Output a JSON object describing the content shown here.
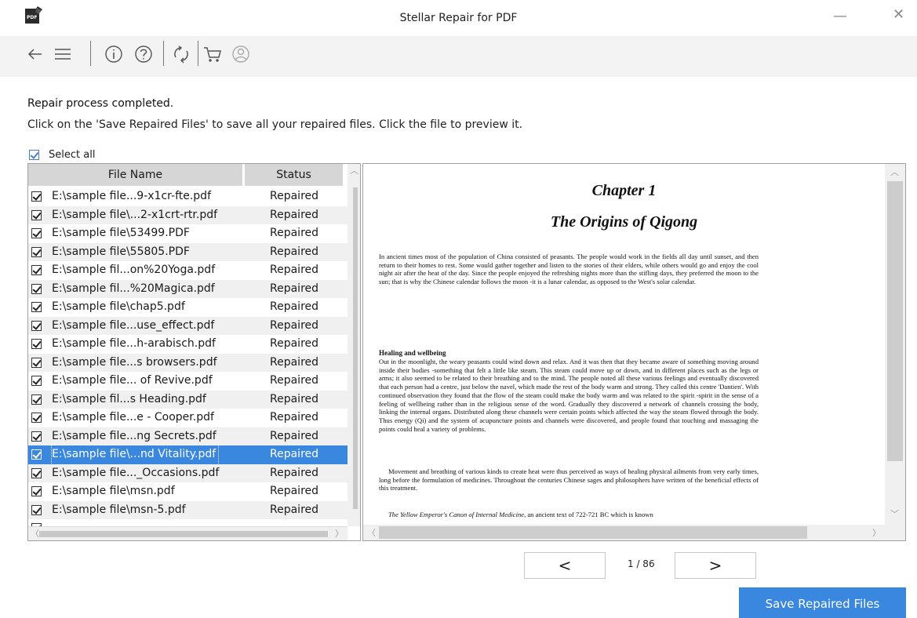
{
  "window": {
    "title": "Stellar Repair for PDF",
    "logo_text": "PDF",
    "minimize": "—",
    "close": "✕"
  },
  "toolbar": {
    "icons": [
      "back-arrow-icon",
      "menu-icon",
      "info-icon",
      "help-icon",
      "refresh-icon",
      "cart-icon",
      "user-icon"
    ]
  },
  "messages": {
    "heading": "Repair process completed.",
    "instruction": "Click on the 'Save Repaired Files' to save all your repaired files. Click the file to preview it."
  },
  "select_all": {
    "label": "Select all",
    "checked": true
  },
  "file_table": {
    "columns": [
      "File Name",
      "Status"
    ],
    "rows": [
      {
        "name": "E:\\sample file...9-x1cr-fte.pdf",
        "status": "Repaired"
      },
      {
        "name": "E:\\sample file\\...2-x1crt-rtr.pdf",
        "status": "Repaired"
      },
      {
        "name": "E:\\sample file\\53499.PDF",
        "status": "Repaired"
      },
      {
        "name": "E:\\sample file\\55805.PDF",
        "status": "Repaired"
      },
      {
        "name": "E:\\sample fil...on%20Yoga.pdf",
        "status": "Repaired"
      },
      {
        "name": "E:\\sample fil...%20Magica.pdf",
        "status": "Repaired"
      },
      {
        "name": "E:\\sample file\\chap5.pdf",
        "status": "Repaired"
      },
      {
        "name": "E:\\sample file...use_effect.pdf",
        "status": "Repaired"
      },
      {
        "name": "E:\\sample file...h-arabisch.pdf",
        "status": "Repaired"
      },
      {
        "name": "E:\\sample file...s browsers.pdf",
        "status": "Repaired"
      },
      {
        "name": "E:\\sample file... of Revive.pdf",
        "status": "Repaired"
      },
      {
        "name": "E:\\sample fil...s Heading.pdf",
        "status": "Repaired"
      },
      {
        "name": "E:\\sample file...e - Cooper.pdf",
        "status": "Repaired"
      },
      {
        "name": "E:\\sample file...ng Secrets.pdf",
        "status": "Repaired"
      },
      {
        "name": "E:\\sample file\\...nd Vitality.pdf",
        "status": "Repaired"
      },
      {
        "name": "E:\\sample file..._Occasions.pdf",
        "status": "Repaired"
      },
      {
        "name": "E:\\sample file\\msn.pdf",
        "status": "Repaired"
      },
      {
        "name": "E:\\sample file\\msn-5.pdf",
        "status": "Repaired"
      }
    ],
    "selected_index": 14
  },
  "preview": {
    "chapter": "Chapter 1",
    "chapter_title": "The Origins of Qigong",
    "para1": "In ancient times most of the population of China consisted of peasants. The people would work in the fields all day until sunset, and then return to their homes to rest. Some would gather together and listen to the stories of their elders, while others would go and enjoy the cool night air after the heat of the day. Since the people enjoyed the refreshing nights more than the stifling days, they preferred the moon to the sun; that is why the Chinese calendar follows the moon -it is a lunar calendar, as opposed to the West's solar calendar.",
    "heading": "Healing and wellbeing",
    "para2": "Out in the moonlight, the weary peasants could wind down and relax. And it was then that they became aware of something moving around inside their bodies -something that felt a little like steam. This steam could move up or down, and in different places such as the legs or arms; it also seemed to be related to their breathing and to the mind. The people noted all these various feelings and eventually discovered that each person had a centre, just below the navel, which made the rest of the body warm and strong. They called this centre 'Dantien'. With continued observation they found that the flow of the steam could make the body warm and was related to the spirit -spirit in the sense of a feeling of wellbeing rather than in the religious sense of the word. Gradually they discovered a network of channels crossing the body, linking the internal organs. Distributed along these channels were certain points which affected the way the steam flowed through the body. Thus energy (Qi) and the system of acupuncture points and channels were discovered, and people found that touching and massaging the points could heal a variety of problems.",
    "para3": "Movement and breathing of various kinds to create heat were thus perceived as ways of healing physical ailments from very early times, long before the formulation of medicines. Throughout the centuries Chinese sages and philosophers have written of the beneficial effects of this treatment.",
    "para4_italic": "The Yellow Emperor's Canon of Internal Medicine,",
    "para4_rest": " an ancient text of 722-721 BC which is known"
  },
  "pager": {
    "prev_label": "<",
    "next_label": ">",
    "page_info": "1 / 86"
  },
  "save_button": {
    "label": "Save Repaired Files",
    "color": "#3a87e0"
  }
}
